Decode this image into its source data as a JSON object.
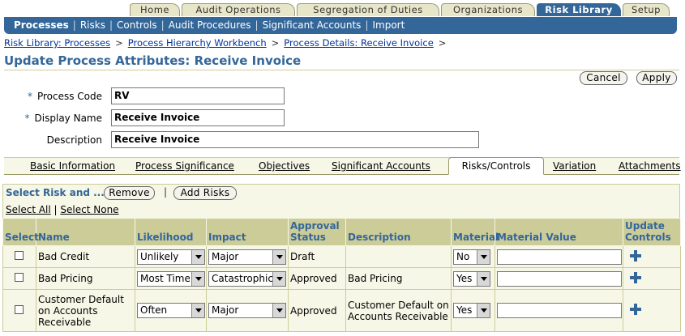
{
  "top_tabs": [
    "Home",
    "Audit Operations",
    "Segregation of Duties",
    "Organizations",
    "Risk Library",
    "Setup"
  ],
  "top_tab_active": "Risk Library",
  "subnav": [
    "Processes",
    "Risks",
    "Controls",
    "Audit Procedures",
    "Significant Accounts",
    "Import"
  ],
  "subnav_active": "Processes",
  "breadcrumb": [
    "Risk Library: Processes",
    "Process Hierarchy Workbench",
    "Process Details: Receive Invoice"
  ],
  "breadcrumb_separator": ">",
  "page_title": "Update Process Attributes: Receive Invoice",
  "buttons": {
    "cancel": "Cancel",
    "apply": "Apply"
  },
  "form": {
    "required_marker": "*",
    "process_code_label": "Process Code",
    "process_code_value": "RV",
    "display_name_label": "Display Name",
    "display_name_value": "Receive Invoice",
    "description_label": "Description",
    "description_value": "Receive Invoice"
  },
  "lower_tabs": [
    "Basic Information",
    "Process Significance",
    "Objectives",
    "Significant Accounts",
    "Risks/Controls",
    "Variation",
    "Attachments"
  ],
  "lower_tab_active": "Risks/Controls",
  "table": {
    "toolbar_label": "Select Risk and ...",
    "remove_button": "Remove",
    "add_risks_button": "Add Risks",
    "toolbar_separator": "|",
    "select_all": "Select All",
    "select_none": "Select None",
    "select_separator": "|",
    "headers": {
      "select": "Select",
      "name": "Name",
      "likelihood": "Likelihood",
      "impact": "Impact",
      "approval_status": "Approval Status",
      "description": "Description",
      "material": "Material",
      "material_value": "Material Value",
      "update_controls": "Update Controls"
    },
    "rows": [
      {
        "name": "Bad Credit",
        "likelihood": "Unlikely",
        "impact": "Major",
        "approval_status": "Draft",
        "description": "",
        "material": "No"
      },
      {
        "name": "Bad Pricing",
        "likelihood": "Most Time",
        "impact": "Catastrophic",
        "approval_status": "Approved",
        "description": "Bad Pricing",
        "material": "Yes"
      },
      {
        "name": "Customer Default on Accounts Receivable",
        "likelihood": "Often",
        "impact": "Major",
        "approval_status": "Approved",
        "description": "Customer Default on Accounts Receivable",
        "material": "Yes"
      }
    ]
  },
  "colors": {
    "brand_blue": "#336699",
    "tan": "#cccc99",
    "cream": "#f7f7e7"
  }
}
